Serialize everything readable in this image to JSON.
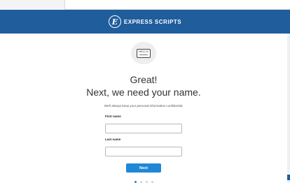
{
  "header": {
    "brand_name": "EXPRESS SCRIPTS",
    "brand_logo_text": "E",
    "background": "#1f5d9c"
  },
  "hero": {
    "badge_text": "HELLO",
    "headline": "Great!",
    "subheadline": "Next, we need your name."
  },
  "privacy_text": "We'll always keep your personal information confidential.",
  "form": {
    "first_name_label": "First name",
    "first_name_value": "",
    "last_name_label": "Last name",
    "last_name_value": ""
  },
  "next_button": {
    "label": "Next",
    "color": "#1f87d6"
  },
  "progress": {
    "current_step": 1,
    "total_steps": 4
  }
}
